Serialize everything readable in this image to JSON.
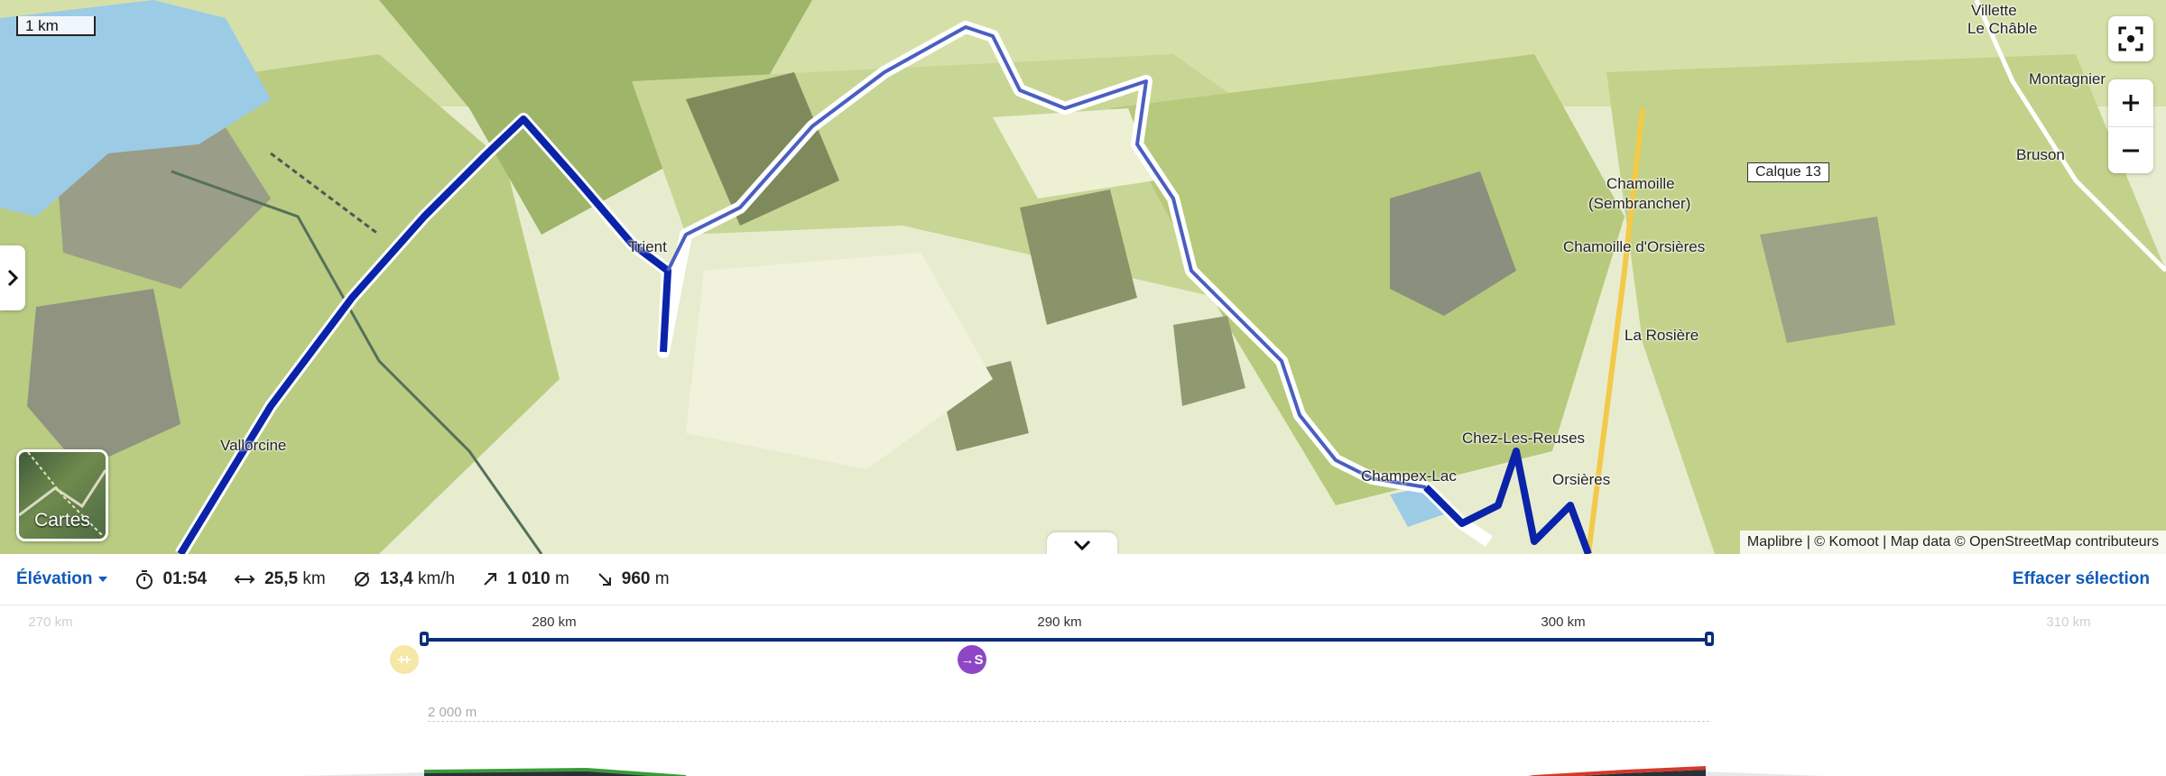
{
  "map": {
    "scale": "1 km",
    "places": {
      "villette": "Villette",
      "le_chable": "Le Châble",
      "montagnier": "Montagnier",
      "bruson": "Bruson",
      "chamoille": "Chamoille",
      "sembrancher": "(Sembrancher)",
      "chamoille_orsieres": "Chamoille d'Orsières",
      "la_rosiere": "La Rosière",
      "trient": "Trient",
      "vallorcine": "Vallorcine",
      "chez_les_reuses": "Chez-Les-Reuses",
      "champex_lac": "Champex-Lac",
      "orsieres": "Orsières"
    },
    "calque": "Calque 13",
    "layers_label": "Cartes",
    "attribution": "Maplibre | © Komoot | Map data © OpenStreetMap contributeurs",
    "icons": {
      "locate": "locate-icon",
      "zoom_in": "plus-icon",
      "zoom_out": "minus-icon",
      "side": "chevron-right-icon",
      "collapse": "chevron-down-icon"
    }
  },
  "stats": {
    "elevation_label": "Élévation",
    "duration": "01:54",
    "distance_value": "25,5",
    "distance_unit": "km",
    "speed_value": "13,4",
    "speed_unit": "km/h",
    "ascent_value": "1 010",
    "ascent_unit": "m",
    "descent_value": "960",
    "descent_unit": "m",
    "clear_selection": "Effacer sélection"
  },
  "elevation": {
    "km_ticks": [
      "270 km",
      "280 km",
      "290 km",
      "300 km",
      "310 km"
    ],
    "altitude_label": "2 000 m",
    "pin_b_label": "→S"
  },
  "colors": {
    "route": "#0a23a8",
    "accent": "#1259b8",
    "selection": "#0c2d7a"
  }
}
